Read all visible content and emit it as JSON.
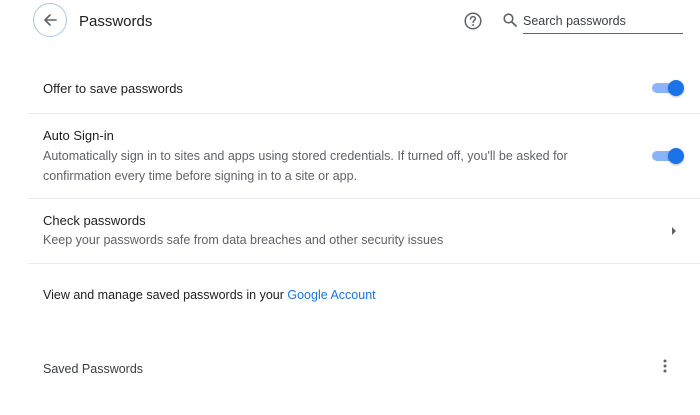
{
  "header": {
    "title": "Passwords",
    "search_placeholder": "Search passwords"
  },
  "settings": {
    "offer_to_save": {
      "label": "Offer to save passwords",
      "enabled": true
    },
    "auto_signin": {
      "label": "Auto Sign-in",
      "description": "Automatically sign in to sites and apps using stored credentials. If turned off, you'll be asked for confirmation every time before signing in to a site or app.",
      "enabled": true
    },
    "check_passwords": {
      "label": "Check passwords",
      "description": "Keep your passwords safe from data breaches and other security issues"
    }
  },
  "manage": {
    "text": "View and manage saved passwords in your ",
    "link": "Google Account"
  },
  "saved_passwords": {
    "title": "Saved Passwords"
  },
  "colors": {
    "accent": "#1a73e8",
    "toggle_track": "#8ab4f8",
    "divider": "#e8eaed"
  },
  "icons": [
    "arrow-back-icon",
    "help-icon",
    "search-icon",
    "chevron-right-icon",
    "more-vert-icon"
  ]
}
